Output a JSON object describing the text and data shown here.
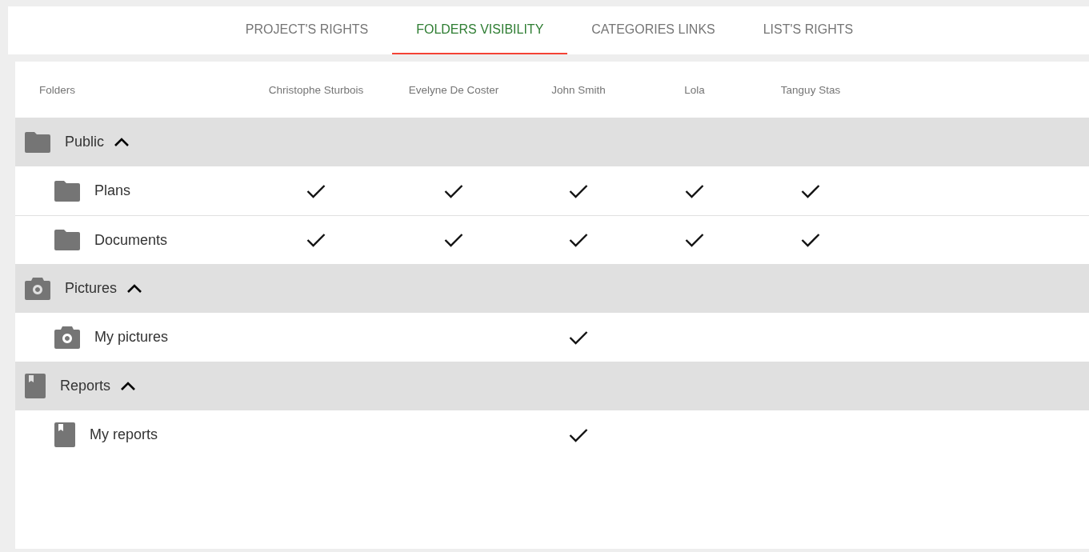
{
  "tabs": [
    {
      "label": "PROJECT'S RIGHTS",
      "selected": false
    },
    {
      "label": "FOLDERS VISIBILITY",
      "selected": true
    },
    {
      "label": "CATEGORIES LINKS",
      "selected": false
    },
    {
      "label": "LIST'S RIGHTS",
      "selected": false
    }
  ],
  "table": {
    "columns": [
      "Folders",
      "Christophe Sturbois",
      "Evelyne De Coster",
      "John Smith",
      "Lola",
      "Tanguy Stas"
    ],
    "groups": [
      {
        "name": "Public",
        "kind": "folder",
        "expanded": true,
        "children": [
          {
            "name": "Plans",
            "kind": "folder",
            "rights": [
              true,
              true,
              true,
              true,
              true
            ]
          },
          {
            "name": "Documents",
            "kind": "folder",
            "rights": [
              true,
              true,
              true,
              true,
              true
            ]
          }
        ]
      },
      {
        "name": "Pictures",
        "kind": "camera",
        "expanded": true,
        "children": [
          {
            "name": "My pictures",
            "kind": "camera",
            "rights": [
              false,
              false,
              true,
              false,
              false
            ]
          }
        ]
      },
      {
        "name": "Reports",
        "kind": "report",
        "expanded": true,
        "children": [
          {
            "name": "My reports",
            "kind": "report",
            "rights": [
              false,
              false,
              true,
              false,
              false
            ]
          }
        ]
      }
    ]
  }
}
